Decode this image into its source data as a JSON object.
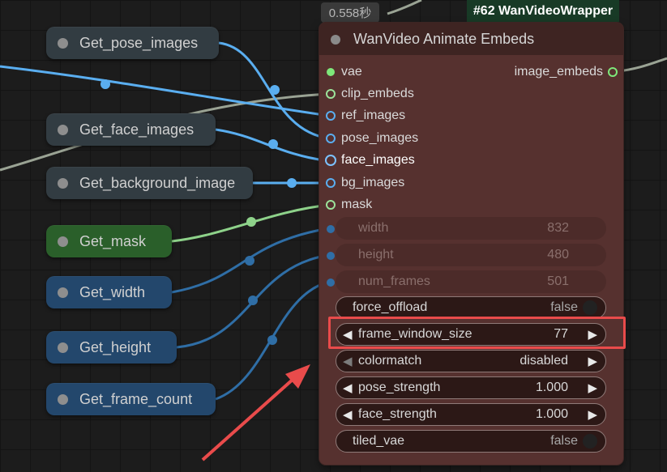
{
  "timer": "0.558秒",
  "node_tag": "#62 WanVideoWrapper",
  "get_nodes": [
    {
      "label": "Get_pose_images"
    },
    {
      "label": "Get_face_images"
    },
    {
      "label": "Get_background_image"
    },
    {
      "label": "Get_mask"
    },
    {
      "label": "Get_width"
    },
    {
      "label": "Get_height"
    },
    {
      "label": "Get_frame_count"
    }
  ],
  "node": {
    "title": "WanVideo Animate Embeds",
    "inputs": [
      "vae",
      "clip_embeds",
      "ref_images",
      "pose_images",
      "face_images",
      "bg_images",
      "mask"
    ],
    "output": "image_embeds",
    "widgets": [
      {
        "label": "width",
        "value": "832"
      },
      {
        "label": "height",
        "value": "480"
      },
      {
        "label": "num_frames",
        "value": "501"
      },
      {
        "label": "force_offload",
        "value": "false"
      },
      {
        "label": "frame_window_size",
        "value": "77"
      },
      {
        "label": "colormatch",
        "value": "disabled"
      },
      {
        "label": "pose_strength",
        "value": "1.000"
      },
      {
        "label": "face_strength",
        "value": "1.000"
      },
      {
        "label": "tiled_vae",
        "value": "false"
      }
    ]
  },
  "colors": {
    "image_link": "#5aaef0",
    "mask_link": "#8ed28a",
    "int_link": "#2f6ea6",
    "clip_link": "#a7b0a0",
    "highlight": "#e94b4b"
  }
}
